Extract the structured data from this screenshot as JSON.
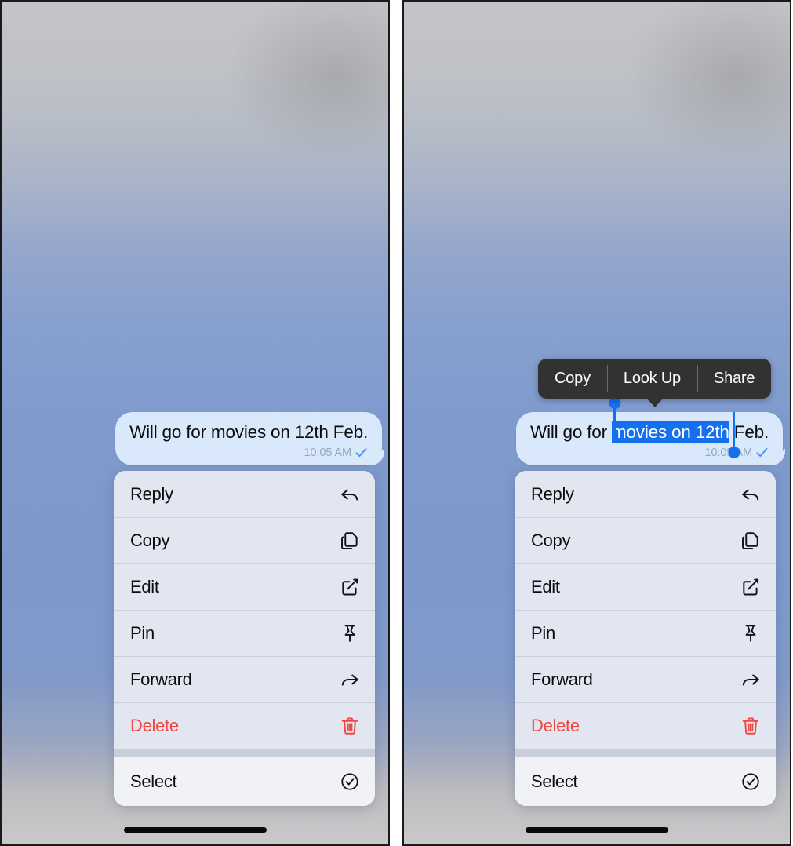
{
  "screens": [
    {
      "id": "left",
      "name": "message-context-menu-screen",
      "message": {
        "text": "Will go for movies on 12th Feb.",
        "time": "10:05 AM",
        "status_icon": "delivered-check-icon"
      },
      "selection": null,
      "edit_menu": null
    },
    {
      "id": "right",
      "name": "message-text-selection-screen",
      "message": {
        "text_before": "Will go for ",
        "text_selected": "movies on 12th",
        "text_after": " Feb.",
        "time": "10:05 AM",
        "status_icon": "delivered-check-icon"
      },
      "edit_menu": {
        "items": [
          {
            "label": "Copy",
            "name": "edit-menu-copy"
          },
          {
            "label": "Look Up",
            "name": "edit-menu-look-up"
          },
          {
            "label": "Share",
            "name": "edit-menu-share"
          }
        ]
      }
    }
  ],
  "context_menu": {
    "items": [
      {
        "label": "Reply",
        "icon": "reply-arrow-icon",
        "destructive": false
      },
      {
        "label": "Copy",
        "icon": "copy-pages-icon",
        "destructive": false
      },
      {
        "label": "Edit",
        "icon": "edit-pencil-square-icon",
        "destructive": false
      },
      {
        "label": "Pin",
        "icon": "pin-icon",
        "destructive": false
      },
      {
        "label": "Forward",
        "icon": "forward-arrow-icon",
        "destructive": false
      },
      {
        "label": "Delete",
        "icon": "trash-icon",
        "destructive": true
      }
    ],
    "footer_item": {
      "label": "Select",
      "icon": "check-circle-icon"
    }
  },
  "colors": {
    "bubble_background": "#d9e8fb",
    "selection_blue": "#1570ef",
    "destructive_red": "#f3463f",
    "edit_menu_background": "#323232",
    "timestamp_gray": "#8fa9c2",
    "check_blue": "#4a93e8"
  },
  "home_indicator": {
    "name": "home-indicator"
  }
}
